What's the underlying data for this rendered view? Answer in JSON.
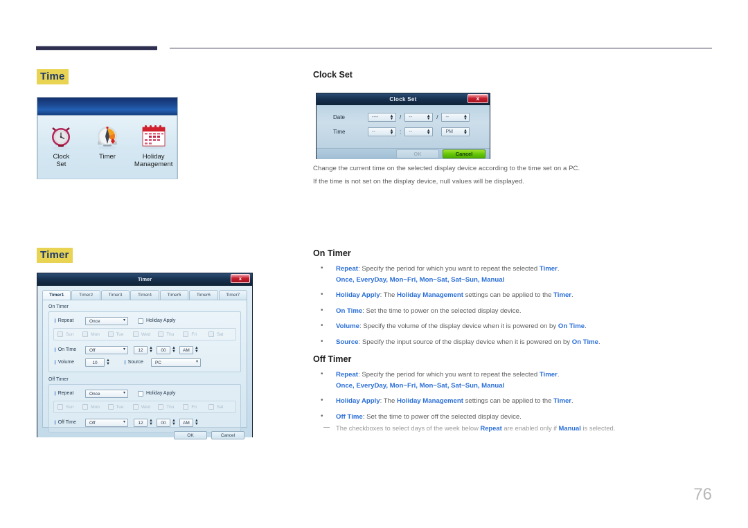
{
  "page": {
    "number": "76"
  },
  "sections": {
    "time_heading": "Time",
    "timer_heading": "Timer"
  },
  "time_panel": {
    "items": [
      {
        "icon": "alarm-clock-icon",
        "label": "Clock\nSet",
        "label_line1": "Clock",
        "label_line2": "Set"
      },
      {
        "icon": "kitchen-timer-icon",
        "label": "Timer",
        "label_line1": "Timer",
        "label_line2": ""
      },
      {
        "icon": "calendar-icon",
        "label": "Holiday Management",
        "label_line1": "Holiday",
        "label_line2": "Management"
      }
    ]
  },
  "clock_set": {
    "heading": "Clock Set",
    "dialog": {
      "title": "Clock Set",
      "close_label": "x",
      "date_label": "Date",
      "time_label": "Time",
      "date_year": "----",
      "date_month": "--",
      "date_day": "--",
      "time_hour": "--",
      "time_minute": "--",
      "time_ampm": "PM",
      "separator_slash": "/",
      "separator_colon": ":",
      "ok_label": "OK",
      "cancel_label": "Cancel"
    },
    "desc1": "Change the current time on the selected display device according to the time set on a PC.",
    "desc2": "If the time is not set on the display device, null values will be displayed."
  },
  "timer_dialog": {
    "title": "Timer",
    "close_label": "x",
    "tabs": [
      "Timer1",
      "Timer2",
      "Timer3",
      "Timer4",
      "Timer5",
      "Timer6",
      "Timer7"
    ],
    "on_timer": {
      "group_label": "On Timer",
      "repeat_label": "Repeat",
      "repeat_value": "Once",
      "holiday_apply_label": "Holiday Apply",
      "days": [
        "Sun",
        "Mon",
        "Tue",
        "Wed",
        "Thu",
        "Fri",
        "Sat"
      ],
      "ontime_label": "On Time",
      "ontime_value": "Off",
      "hour": "12",
      "minute": "00",
      "ampm": "AM",
      "volume_label": "Volume",
      "volume_value": "10",
      "source_label": "Source",
      "source_value": "PC"
    },
    "off_timer": {
      "group_label": "Off Timer",
      "repeat_label": "Repeat",
      "repeat_value": "Once",
      "holiday_apply_label": "Holiday Apply",
      "days": [
        "Sun",
        "Mon",
        "Tue",
        "Wed",
        "Thu",
        "Fri",
        "Sat"
      ],
      "offtime_label": "Off Time",
      "offtime_value": "Off",
      "hour": "12",
      "minute": "00",
      "ampm": "AM"
    },
    "ok_label": "OK",
    "cancel_label": "Cancel"
  },
  "on_timer_doc": {
    "heading": "On Timer",
    "bullets": [
      {
        "term": "Repeat",
        "text": ": Specify the period for which you want to repeat the selected ",
        "term2": "Timer",
        "tail": ".",
        "options": "Once, EveryDay, Mon~Fri, Mon~Sat, Sat~Sun, Manual"
      },
      {
        "term": "Holiday Apply",
        "text": ": The ",
        "term2": "Holiday Management",
        "text2": " settings can be applied to the ",
        "term3": "Timer",
        "tail": "."
      },
      {
        "term": "On Time",
        "text": ": Set the time to power on the selected display device."
      },
      {
        "term": "Volume",
        "text": ": Specify the volume of the display device when it is powered on by ",
        "term2": "On Time",
        "tail": "."
      },
      {
        "term": "Source",
        "text": ": Specify the input source of the display device when it is powered on by ",
        "term2": "On Time",
        "tail": "."
      }
    ]
  },
  "off_timer_doc": {
    "heading": "Off Timer",
    "bullets": [
      {
        "term": "Repeat",
        "text": ": Specify the period for which you want to repeat the selected ",
        "term2": "Timer",
        "tail": ".",
        "options": "Once, EveryDay, Mon~Fri, Mon~Sat, Sat~Sun, Manual"
      },
      {
        "term": "Holiday Apply",
        "text": ": The ",
        "term2": "Holiday Management",
        "text2": " settings can be applied to the ",
        "term3": "Timer",
        "tail": "."
      },
      {
        "term": "Off Time",
        "text": ": Set the time to power off the selected display device."
      }
    ],
    "note": {
      "pre": "The checkboxes to select days of the week below ",
      "term": "Repeat",
      "mid": " are enabled only if ",
      "term2": "Manual",
      "post": " is selected."
    }
  },
  "colors": {
    "highlight": "#e9d352",
    "heading_text": "#1d3a6b",
    "link_blue": "#2b6fd6",
    "body_gray": "#5c5c5c",
    "rule_navy": "#2e2f4f"
  }
}
